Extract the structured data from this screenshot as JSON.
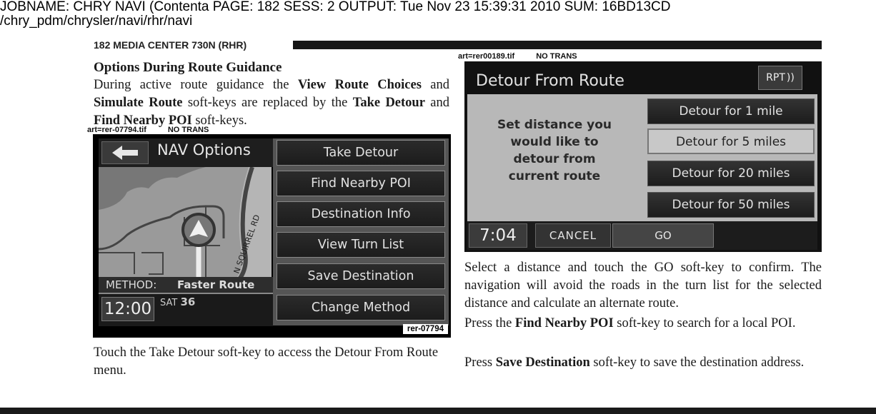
{
  "job_header": {
    "line1": "JOBNAME: CHRY NAVI (Contenta   PAGE: 182  SESS: 2  OUTPUT: Tue Nov 23 15:39:31 2010  SUM: 16BD13CD",
    "line2": "/chry_pdm/chrysler/navi/rhr/navi"
  },
  "running_head": "182   MEDIA CENTER 730N (RHR)",
  "left_column": {
    "heading": "Options During Route Guidance",
    "para1": {
      "t1": "During active route guidance the ",
      "b1": "View Route Choices",
      "t2": " and ",
      "b2": "Simulate Route",
      "t3": " soft-keys are replaced by the ",
      "b3": "Take Detour",
      "t4": " and ",
      "b4": "Find Nearby POI",
      "t5": " soft-keys."
    },
    "art_label": "art=rer-07794.tif",
    "art_label_note": "NO TRANS",
    "para2": "Touch the Take Detour soft-key to access the Detour From Route menu."
  },
  "nav_options_screen": {
    "title": "NAV Options",
    "back_icon": "left-arrow-icon",
    "road_label": "N SQUIRREL RD",
    "method_label": "METHOD:",
    "method_value": "Faster Route",
    "clock": "12:00",
    "sat": "SAT",
    "sat_count": "36",
    "softkeys": [
      "Take Detour",
      "Find Nearby POI",
      "Destination Info",
      "View Turn List",
      "Save Destination",
      "Change Method"
    ],
    "figure_tag": "rer-07794"
  },
  "right_column": {
    "art_label": "art=rer00189.tif",
    "art_label_note": "NO TRANS",
    "para1": "Select a distance and touch the GO soft-key to confirm. The navigation will avoid the roads in the turn list for the selected distance and calculate an alternate route.",
    "para2": {
      "t1": "Press the ",
      "b1": "Find Nearby POI",
      "t2": " soft-key to search for a local POI."
    },
    "para3": {
      "t1": "Press ",
      "b1": "Save Destination",
      "t2": " soft-key to save the destination address."
    }
  },
  "detour_screen": {
    "title": "Detour From Route",
    "rpt_label": "RPT",
    "rpt_icon": "sound-waves-icon",
    "prompt_lines": [
      "Set distance you",
      "would like to",
      "detour from",
      "current route"
    ],
    "options": [
      {
        "label": "Detour for 1 mile",
        "selected": false
      },
      {
        "label": "Detour for 5 miles",
        "selected": true
      },
      {
        "label": "Detour for 20 miles",
        "selected": false
      },
      {
        "label": "Detour for 50 miles",
        "selected": false
      }
    ],
    "clock": "7:04",
    "cancel_label": "CANCEL",
    "go_label": "GO"
  }
}
